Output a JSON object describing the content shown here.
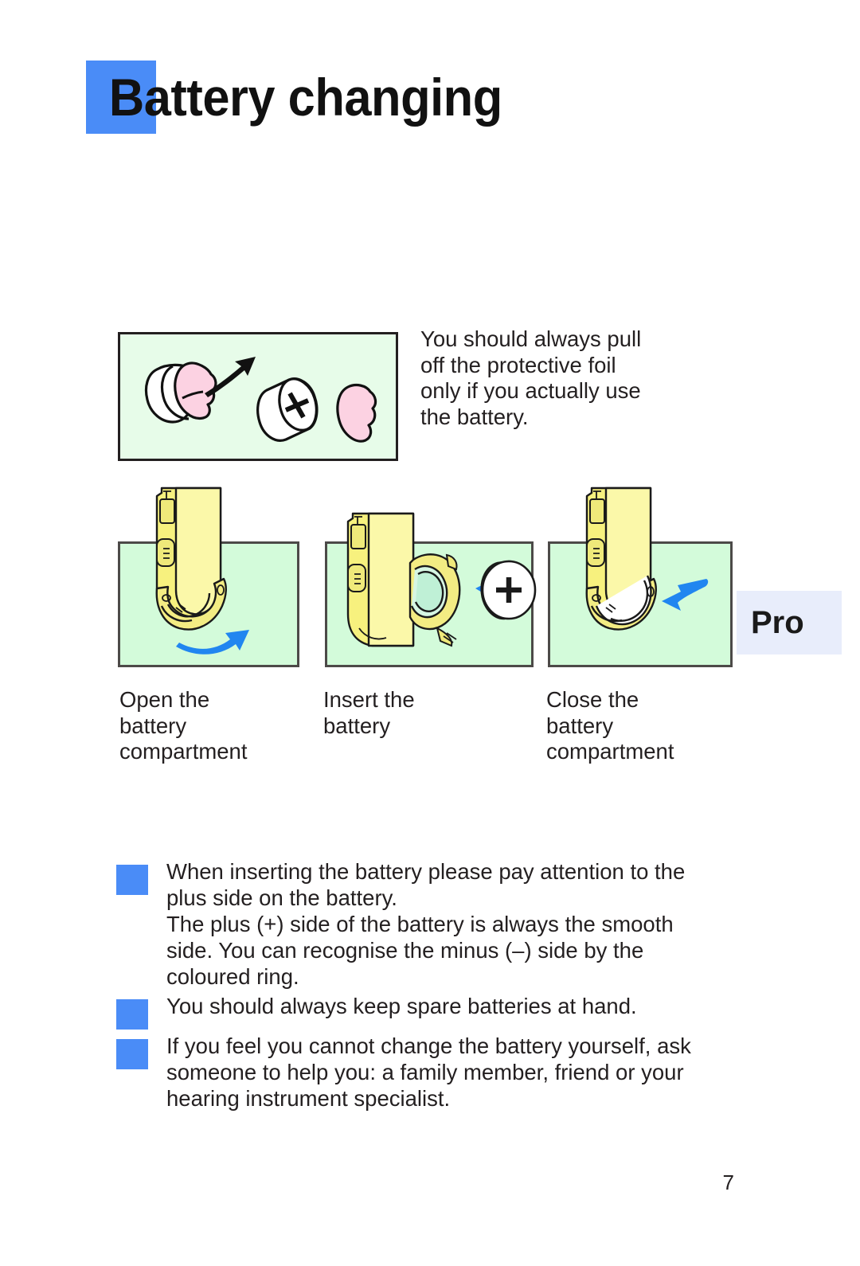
{
  "page": {
    "title": "Battery changing",
    "number": "7",
    "accent_color": "#4a8cf7",
    "panel_green": "#e7fce9",
    "panel_green_steps": "#d3fbda",
    "pro_badge_bg": "#e8edfb"
  },
  "foil_note": {
    "lines": [
      "You should always pull",
      "off the protective foil",
      "only if you actually use",
      "the battery."
    ]
  },
  "pro_badge": {
    "label": "Pro"
  },
  "steps": [
    {
      "id": "open",
      "icon": "hearing-aid-open-icon",
      "caption_lines": [
        "Open the",
        "battery",
        "compartment"
      ]
    },
    {
      "id": "insert",
      "icon": "hearing-aid-insert-battery-icon",
      "battery_marking": "+",
      "caption_lines": [
        "Insert the",
        "battery"
      ]
    },
    {
      "id": "close",
      "icon": "hearing-aid-close-icon",
      "caption_lines": [
        "Close the",
        "battery",
        "compartment"
      ]
    }
  ],
  "foil_illustration": {
    "battery_marking": "+",
    "icon": "battery-peel-foil-icon"
  },
  "notes": [
    {
      "lines": [
        "When inserting the battery please pay attention to the",
        "plus side on the battery.",
        "The plus (+) side of the battery is always the smooth",
        "side. You can recognise the minus (–) side by the",
        "coloured ring."
      ]
    },
    {
      "lines": [
        "You should always keep spare batteries at hand."
      ]
    },
    {
      "lines": [
        "If you feel you cannot change the battery yourself, ask",
        "someone to help you: a family member, friend or your",
        "hearing instrument specialist."
      ]
    }
  ]
}
